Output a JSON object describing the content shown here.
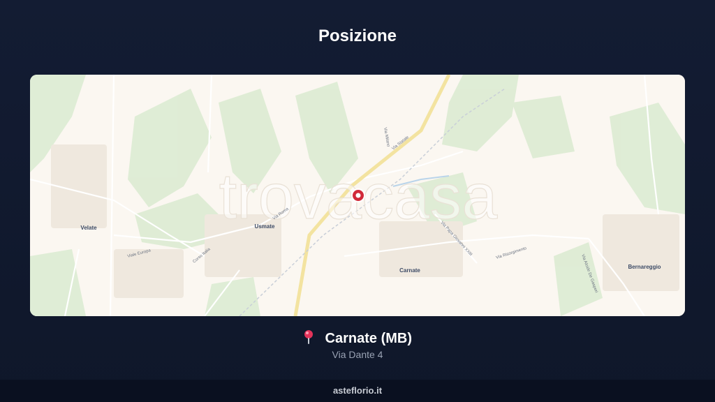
{
  "page": {
    "title": "Posizione"
  },
  "map": {
    "watermark": "trovacasa",
    "towns": [
      "Velate",
      "Usmate",
      "Carnate",
      "Bernareggio"
    ],
    "streets": [
      "Via Stazione",
      "Via Statale",
      "Via Milano",
      "Via Roma",
      "Corso Italia",
      "Viale Europa",
      "Via Risorgimento",
      "Via Alcide De Gasperi",
      "Via Papa Giovanni XXIII"
    ],
    "colors": {
      "marker": "#d12a3a",
      "road_major": "#f3e3a0",
      "park": "#d7e8cf"
    }
  },
  "location": {
    "name": "Carnate (MB)",
    "address": "Via Dante 4",
    "icon": "pin-icon"
  },
  "footer": {
    "brand": "asteflorio.it"
  }
}
